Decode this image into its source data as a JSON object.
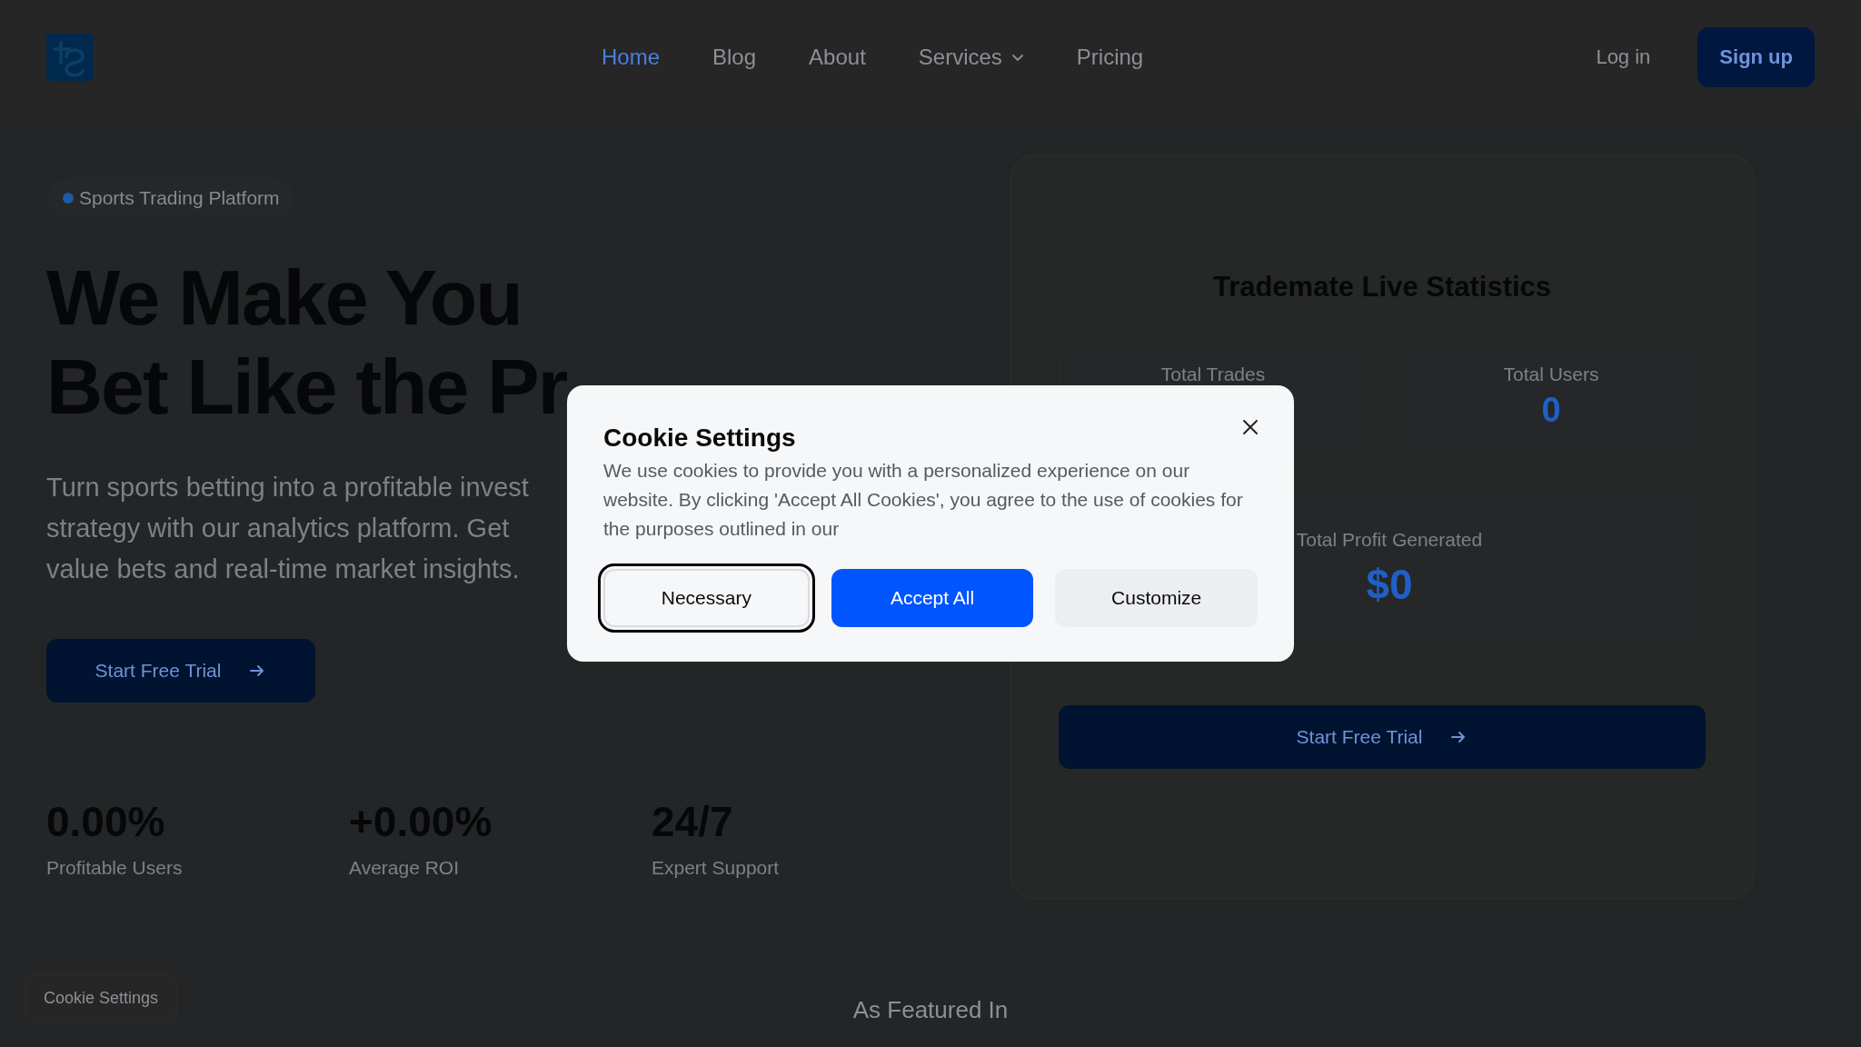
{
  "nav": {
    "links": [
      {
        "label": "Home",
        "selected": true,
        "dropdown": false
      },
      {
        "label": "Blog",
        "selected": false,
        "dropdown": false
      },
      {
        "label": "About",
        "selected": false,
        "dropdown": false
      },
      {
        "label": "Services",
        "selected": false,
        "dropdown": true
      },
      {
        "label": "Pricing",
        "selected": false,
        "dropdown": false
      }
    ],
    "login": "Log in",
    "signup": "Sign up"
  },
  "hero": {
    "badge": "Sports Trading Platform",
    "headline": [
      "We Make You",
      "Bet Like the Pr"
    ],
    "subtitle": [
      "Turn sports betting into a profitable invest",
      "strategy with our analytics platform. Get",
      "value bets and real-time market insights."
    ],
    "cta": "Start Free Trial",
    "stats": [
      {
        "value": "0.00%",
        "label": "Profitable Users"
      },
      {
        "value": "+0.00%",
        "label": "Average ROI"
      },
      {
        "value": "24/7",
        "label": "Expert Support"
      }
    ]
  },
  "stats_card": {
    "title": "Trademate Live Statistics",
    "tiles": [
      {
        "label": "Total Trades",
        "wide": false
      },
      {
        "label": "Total Users",
        "value": "0",
        "wide": false
      },
      {
        "label": "Total Profit Generated",
        "value": "$0",
        "wide": true
      }
    ],
    "cta": "Start Free Trial"
  },
  "featured": {
    "title": "As Featured In"
  },
  "cookie_button": "Cookie Settings",
  "cookie_modal": {
    "title": "Cookie Settings",
    "text": "We use cookies to provide you with a personalized experience on our website. By clicking 'Accept All Cookies', you agree to the use of cookies for the purposes outlined in our",
    "buttons": [
      {
        "label": "Necessary",
        "kind": "outline",
        "focused": true
      },
      {
        "label": "Accept All",
        "kind": "primary",
        "focused": false
      },
      {
        "label": "Customize",
        "kind": "secondary",
        "focused": false
      }
    ]
  }
}
